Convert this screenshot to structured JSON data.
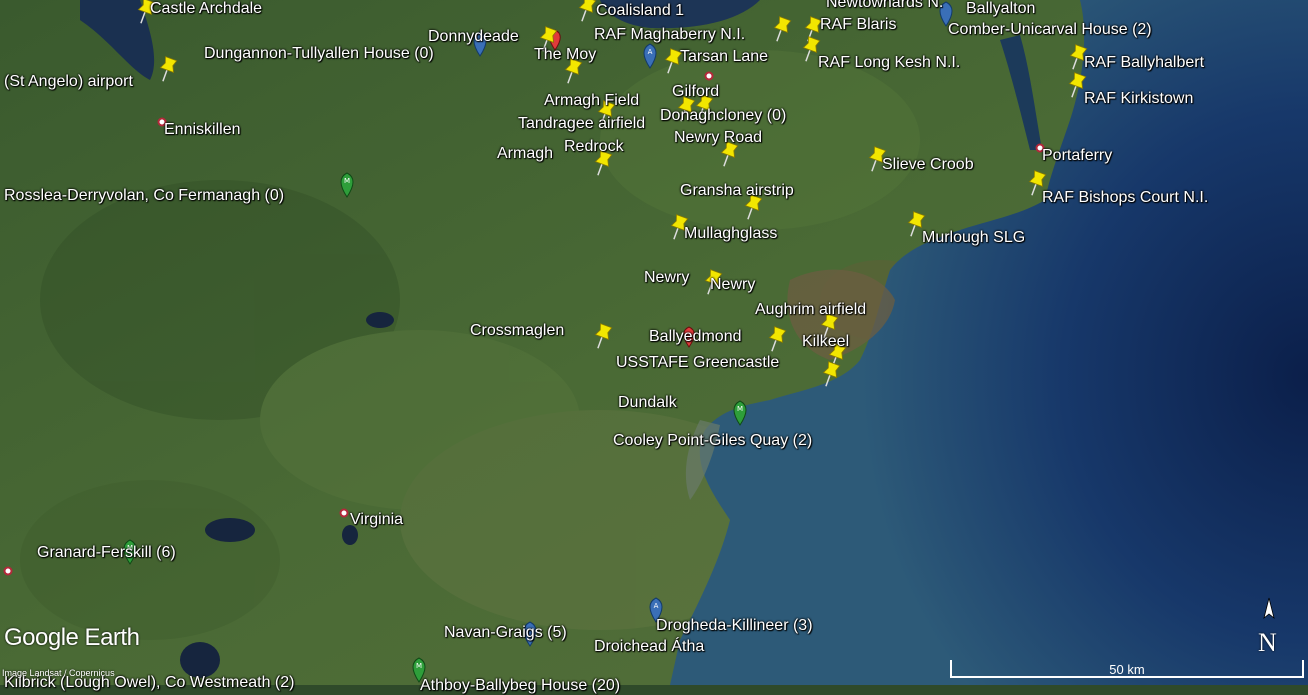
{
  "map": {
    "labels": [
      {
        "id": "castle-archdale",
        "text": "Castle Archdale"
      },
      {
        "id": "coalisland",
        "text": "Coalisland 1"
      },
      {
        "id": "newtownards",
        "text": "Newtownards N."
      },
      {
        "id": "ballyalton",
        "text": "Ballyalton"
      },
      {
        "id": "donnydeade",
        "text": "Donnydeade"
      },
      {
        "id": "raf-maghaberry",
        "text": "RAF Maghaberry N.I."
      },
      {
        "id": "raf-blaris",
        "text": "RAF Blaris"
      },
      {
        "id": "comber",
        "text": "Comber-Unicarval House (2)"
      },
      {
        "id": "dungannon",
        "text": "Dungannon-Tullyallen House (0)"
      },
      {
        "id": "the-moy",
        "text": "The Moy"
      },
      {
        "id": "tarsan-lane",
        "text": "Tarsan Lane"
      },
      {
        "id": "raf-long-kesh",
        "text": "RAF Long Kesh N.I."
      },
      {
        "id": "raf-ballyhalbert",
        "text": "RAF Ballyhalbert"
      },
      {
        "id": "st-angelo",
        "text": "(St Angelo) airport"
      },
      {
        "id": "gilford",
        "text": "Gilford"
      },
      {
        "id": "raf-kirkistown",
        "text": "RAF Kirkistown"
      },
      {
        "id": "armagh-field",
        "text": "Armagh Field"
      },
      {
        "id": "tandragee",
        "text": "Tandragee airfield"
      },
      {
        "id": "donaghcloney",
        "text": "Donaghcloney (0)"
      },
      {
        "id": "enniskillen",
        "text": "Enniskillen"
      },
      {
        "id": "newry-road",
        "text": "Newry Road"
      },
      {
        "id": "armagh",
        "text": "Armagh"
      },
      {
        "id": "redrock",
        "text": "Redrock"
      },
      {
        "id": "portaferry",
        "text": "Portaferry"
      },
      {
        "id": "slieve-croob",
        "text": "Slieve Croob"
      },
      {
        "id": "rosslea",
        "text": "Rosslea-Derryvolan, Co Fermanagh (0)"
      },
      {
        "id": "gransha",
        "text": "Gransha airstrip"
      },
      {
        "id": "raf-bishops-court",
        "text": "RAF Bishops Court N.I."
      },
      {
        "id": "mullaghglass",
        "text": "Mullaghglass"
      },
      {
        "id": "murlough",
        "text": "Murlough SLG"
      },
      {
        "id": "newry-1",
        "text": "Newry"
      },
      {
        "id": "newry-2",
        "text": "Newry"
      },
      {
        "id": "aughrim",
        "text": "Aughrim airfield"
      },
      {
        "id": "crossmaglen",
        "text": "Crossmaglen"
      },
      {
        "id": "ballyedmond",
        "text": "Ballyedmond"
      },
      {
        "id": "kilkeel",
        "text": "Kilkeel"
      },
      {
        "id": "usstafe",
        "text": "USSTAFE Greencastle"
      },
      {
        "id": "dundalk",
        "text": "Dundalk"
      },
      {
        "id": "cooley-point",
        "text": "Cooley Point-Giles Quay (2)"
      },
      {
        "id": "virginia",
        "text": "Virginia"
      },
      {
        "id": "granard",
        "text": "Granard-Ferskill (6)"
      },
      {
        "id": "drogheda",
        "text": "Drogheda-Killineer (3)"
      },
      {
        "id": "navan",
        "text": "Navan-Graigs (5)"
      },
      {
        "id": "droichead-atha",
        "text": "Droichead Átha"
      },
      {
        "id": "kilbrick",
        "text": "Kilbrick (Lough Owel), Co Westmeath (2)"
      },
      {
        "id": "athboy",
        "text": "Athboy-Ballybeg House (20)"
      }
    ]
  },
  "branding": {
    "logo": "Google Earth",
    "credit": "Image Landsat / Copernicus"
  },
  "compass": {
    "letter": "N"
  },
  "scale": {
    "text": "50 km"
  },
  "colors": {
    "pushpin": "#f2e600",
    "marker_green": "#2e9e3a",
    "marker_blue": "#3a6fb7",
    "marker_red": "#e03b3b",
    "town_dot": "#b4283a"
  }
}
